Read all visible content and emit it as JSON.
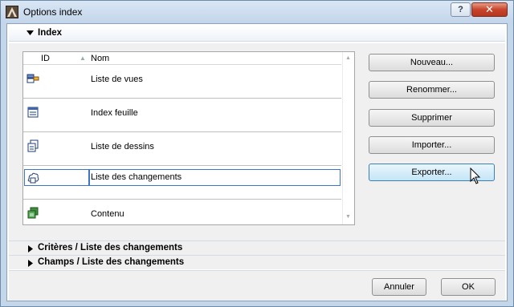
{
  "window": {
    "title": "Options index",
    "help_label": "?",
    "close_label": "✕"
  },
  "index_section": {
    "label": "Index",
    "columns": {
      "id": "ID",
      "name": "Nom"
    },
    "rows": [
      {
        "id": "",
        "name": "Liste de vues",
        "icon": "view-list-icon"
      },
      {
        "id": "",
        "name": "Index feuille",
        "icon": "sheet-index-icon"
      },
      {
        "id": "",
        "name": "Liste de dessins",
        "icon": "drawing-list-icon"
      },
      {
        "id": "",
        "name": "Liste des changements",
        "icon": "change-list-icon",
        "selected": true
      },
      {
        "id": "",
        "name": "Contenu",
        "icon": "contents-icon"
      }
    ]
  },
  "actions": {
    "new_label": "Nouveau...",
    "rename_label": "Renommer...",
    "delete_label": "Supprimer",
    "import_label": "Importer...",
    "export_label": "Exporter..."
  },
  "criteria_section": {
    "label": "Critères /  Liste des changements"
  },
  "fields_section": {
    "label": "Champs /  Liste des changements"
  },
  "footer": {
    "cancel_label": "Annuler",
    "ok_label": "OK"
  },
  "colors": {
    "title_bar": "#c4d6ea",
    "selection_border": "#3b75c4",
    "hover_button": "#c4e5f6",
    "close_button": "#c7452d"
  }
}
